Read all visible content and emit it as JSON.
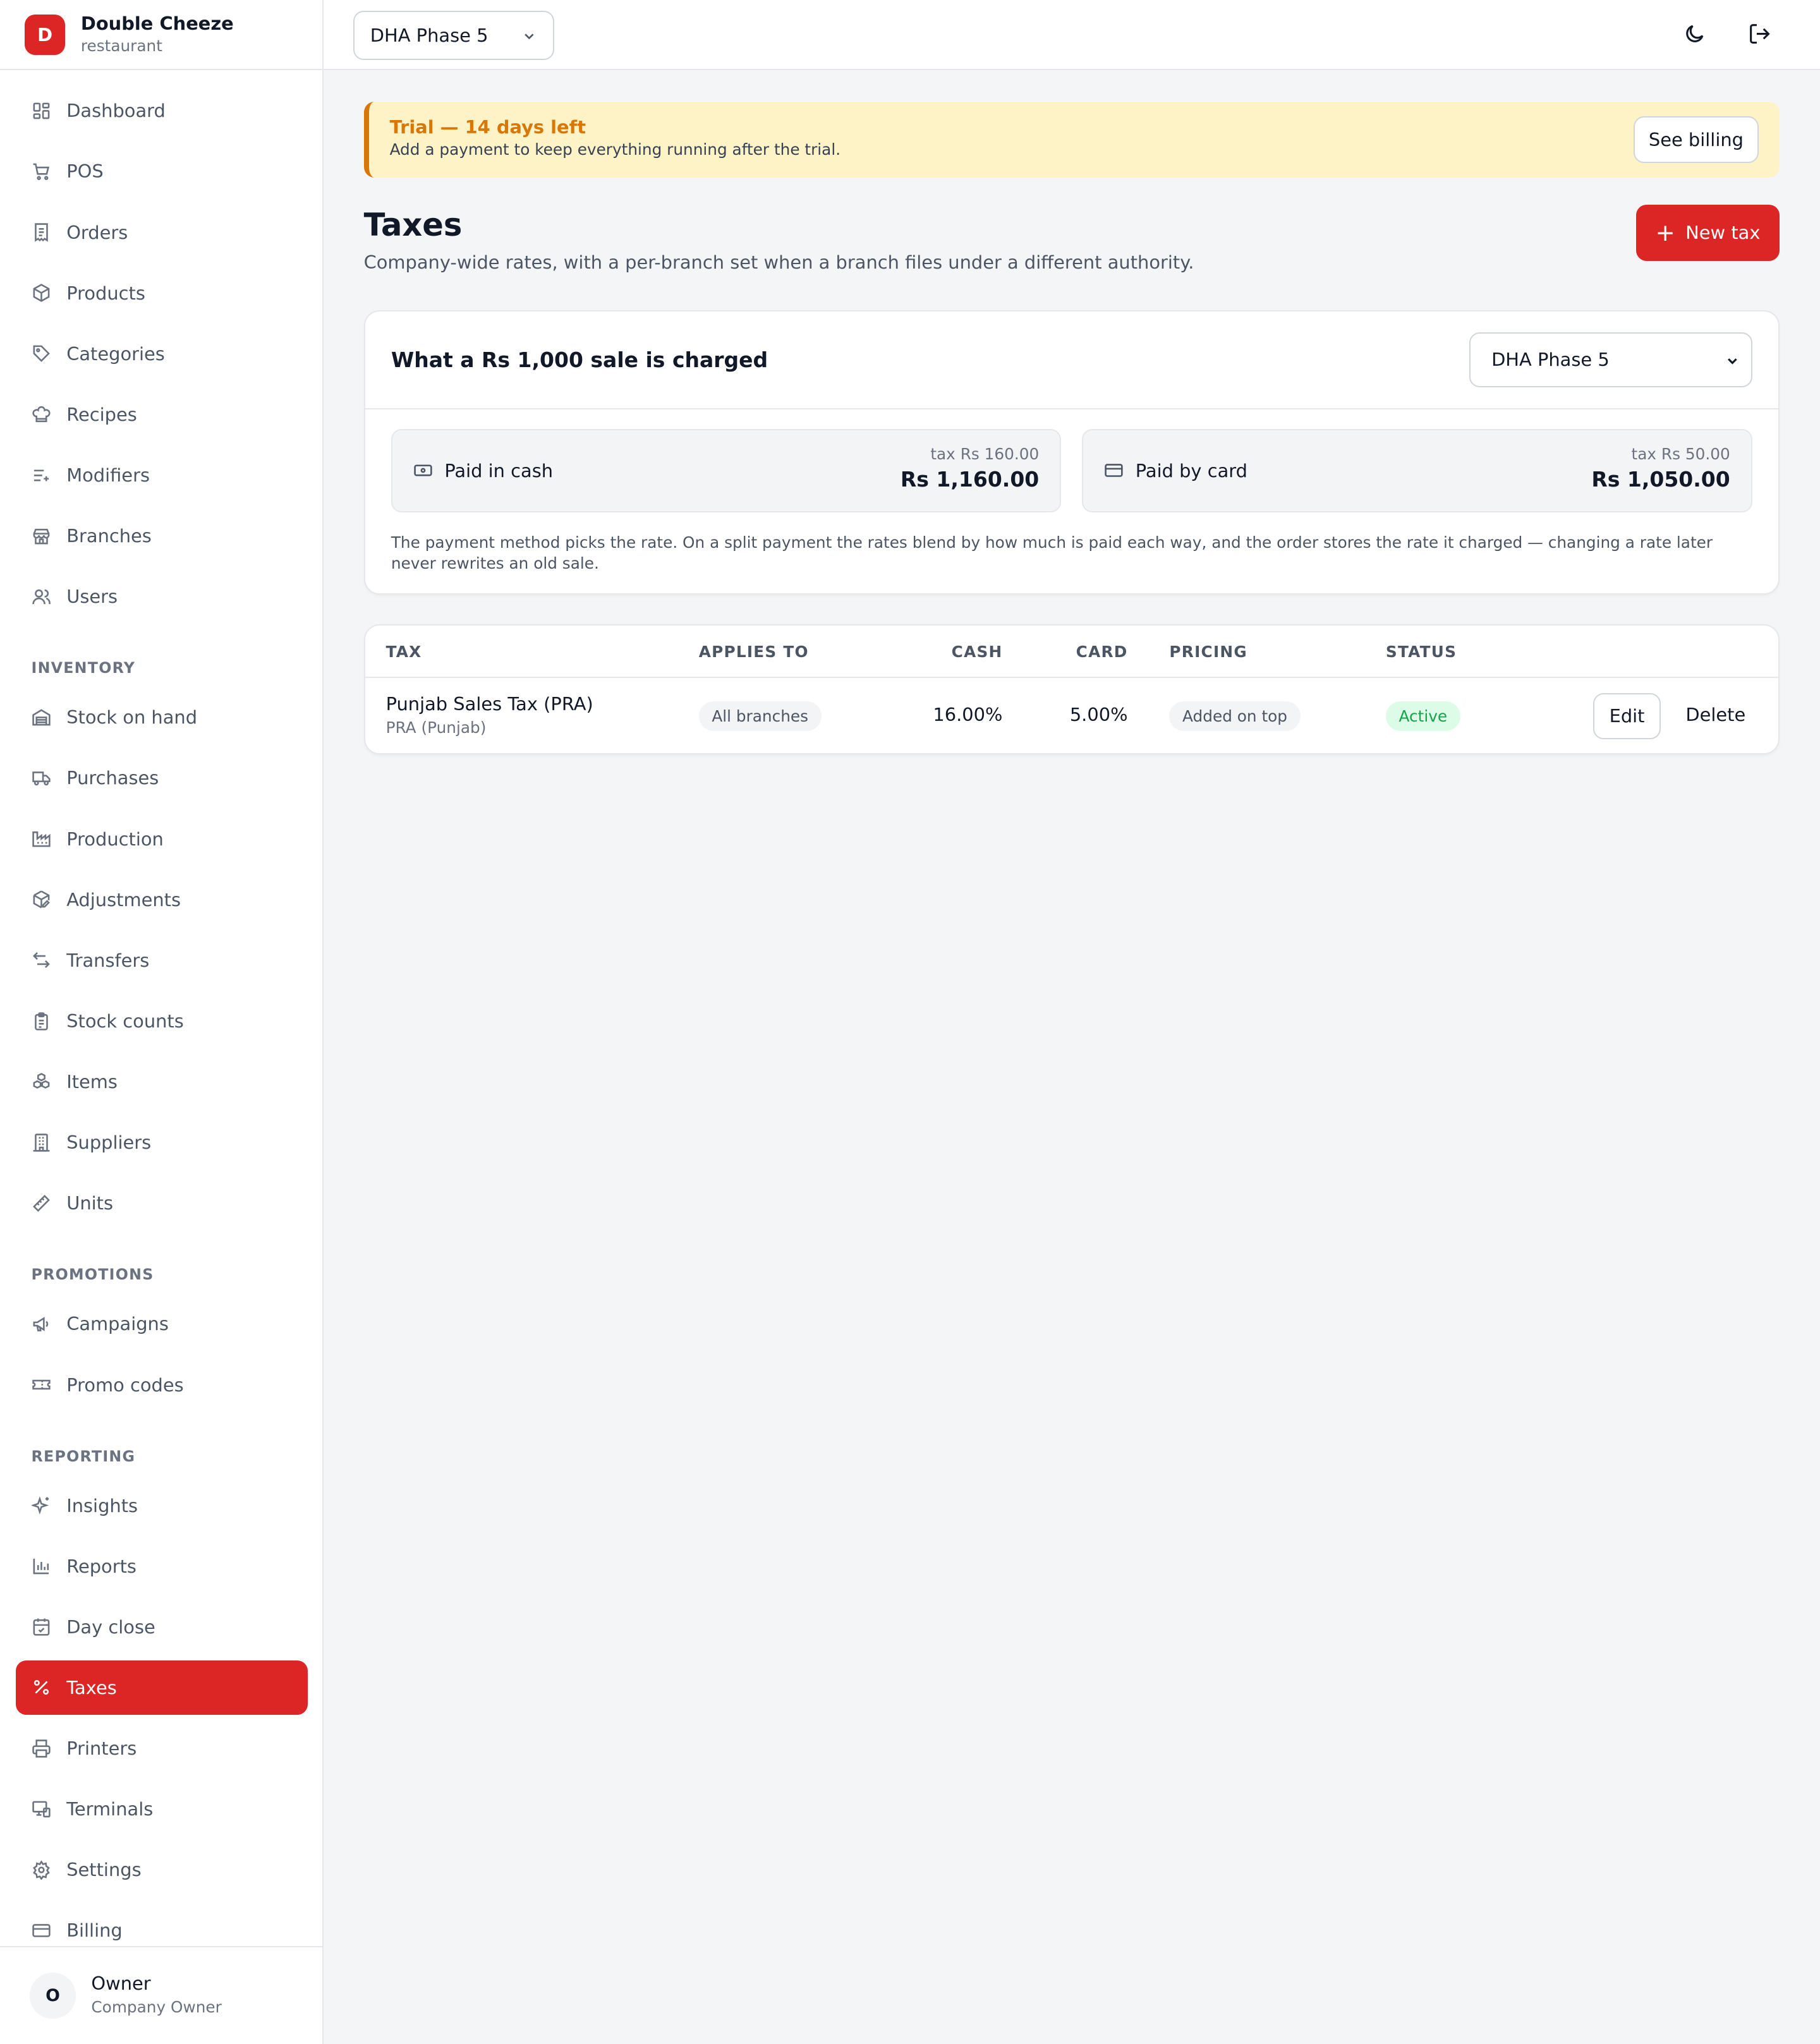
{
  "brand": {
    "initial": "D",
    "name": "Double Cheeze",
    "type": "restaurant"
  },
  "nav": {
    "main": [
      {
        "label": "Dashboard",
        "icon": "dashboard-icon"
      },
      {
        "label": "POS",
        "icon": "cart-icon"
      },
      {
        "label": "Orders",
        "icon": "receipt-icon"
      },
      {
        "label": "Products",
        "icon": "box-icon"
      },
      {
        "label": "Categories",
        "icon": "tag-icon"
      },
      {
        "label": "Recipes",
        "icon": "chef-hat-icon"
      },
      {
        "label": "Modifiers",
        "icon": "list-plus-icon"
      },
      {
        "label": "Branches",
        "icon": "store-icon"
      },
      {
        "label": "Users",
        "icon": "users-icon"
      }
    ],
    "inventory_heading": "INVENTORY",
    "inventory": [
      {
        "label": "Stock on hand",
        "icon": "warehouse-icon"
      },
      {
        "label": "Purchases",
        "icon": "truck-icon"
      },
      {
        "label": "Production",
        "icon": "factory-icon"
      },
      {
        "label": "Adjustments",
        "icon": "package-edit-icon"
      },
      {
        "label": "Transfers",
        "icon": "arrows-swap-icon"
      },
      {
        "label": "Stock counts",
        "icon": "clipboard-list-icon"
      },
      {
        "label": "Items",
        "icon": "cubes-icon"
      },
      {
        "label": "Suppliers",
        "icon": "building-icon"
      },
      {
        "label": "Units",
        "icon": "ruler-icon"
      }
    ],
    "promotions_heading": "PROMOTIONS",
    "promotions": [
      {
        "label": "Campaigns",
        "icon": "megaphone-icon"
      },
      {
        "label": "Promo codes",
        "icon": "ticket-icon"
      }
    ],
    "reporting_heading": "REPORTING",
    "reporting": [
      {
        "label": "Insights",
        "icon": "sparkles-icon"
      },
      {
        "label": "Reports",
        "icon": "bar-chart-icon"
      },
      {
        "label": "Day close",
        "icon": "calendar-check-icon"
      },
      {
        "label": "Taxes",
        "icon": "percent-icon",
        "active": true
      },
      {
        "label": "Printers",
        "icon": "printer-icon"
      },
      {
        "label": "Terminals",
        "icon": "terminal-icon"
      },
      {
        "label": "Settings",
        "icon": "gear-icon"
      },
      {
        "label": "Billing",
        "icon": "credit-card-icon"
      }
    ]
  },
  "user": {
    "initial": "O",
    "name": "Owner",
    "role": "Company Owner"
  },
  "topbar": {
    "branch": "DHA Phase 5",
    "icons": [
      "moon-icon",
      "logout-icon"
    ]
  },
  "trial": {
    "title": "Trial — 14 days left",
    "subtitle": "Add a payment to keep everything running after the trial.",
    "button": "See billing"
  },
  "page": {
    "title": "Taxes",
    "subtitle": "Company-wide rates, with a per-branch set when a branch files under a different authority.",
    "new_button": "New tax"
  },
  "sale_preview": {
    "title": "What a Rs 1,000 sale is charged",
    "branch": "DHA Phase 5",
    "cash": {
      "label": "Paid in cash",
      "tax": "tax Rs 160.00",
      "total": "Rs 1,160.00"
    },
    "card": {
      "label": "Paid by card",
      "tax": "tax Rs 50.00",
      "total": "Rs 1,050.00"
    },
    "note": "The payment method picks the rate. On a split payment the rates blend by how much is paid each way, and the order stores the rate it charged — changing a rate later never rewrites an old sale."
  },
  "tax_table": {
    "headers": {
      "tax": "TAX",
      "applies_to": "APPLIES TO",
      "cash": "CASH",
      "card": "CARD",
      "pricing": "PRICING",
      "status": "STATUS"
    },
    "rows": [
      {
        "name": "Punjab Sales Tax (PRA)",
        "authority": "PRA (Punjab)",
        "applies_to": "All branches",
        "cash": "16.00%",
        "card": "5.00%",
        "pricing": "Added on top",
        "status": "Active",
        "edit": "Edit",
        "delete": "Delete"
      }
    ]
  },
  "colors": {
    "accent": "#dc2626",
    "warning": "#d97706",
    "warning_bg": "#fef3c7",
    "success": "#16a34a"
  }
}
